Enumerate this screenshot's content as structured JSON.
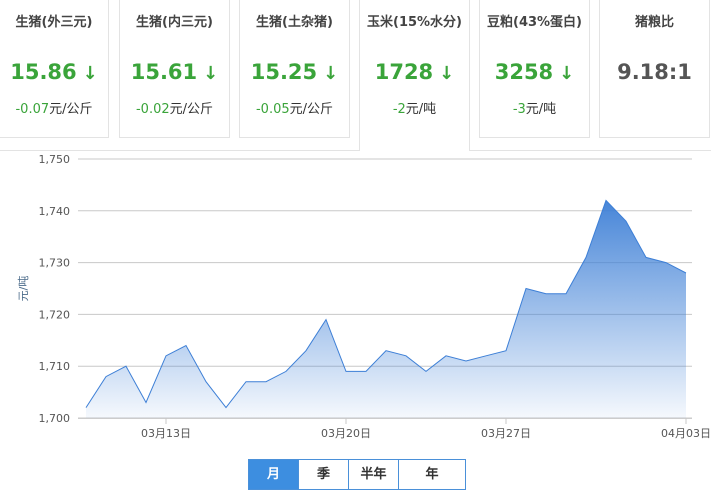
{
  "cards": [
    {
      "title": "生猪(外三元)",
      "value": "15.86",
      "arrow": "↓",
      "change": "-0.07",
      "unit": "元/公斤"
    },
    {
      "title": "生猪(内三元)",
      "value": "15.61",
      "arrow": "↓",
      "change": "-0.02",
      "unit": "元/公斤"
    },
    {
      "title": "生猪(土杂猪)",
      "value": "15.25",
      "arrow": "↓",
      "change": "-0.05",
      "unit": "元/公斤"
    },
    {
      "title": "玉米(15%水分)",
      "value": "1728",
      "arrow": "↓",
      "change": "-2",
      "unit": "元/吨"
    },
    {
      "title": "豆粕(43%蛋白)",
      "value": "3258",
      "arrow": "↓",
      "change": "-3",
      "unit": "元/吨"
    },
    {
      "title": "猪粮比",
      "value": "9.18:1"
    }
  ],
  "tabs": [
    "月",
    "季",
    "半年",
    "年"
  ],
  "colors": {
    "down": "#3aa43a",
    "line": "#3d7fd6",
    "active_tab": "#3d8ee0"
  },
  "chart_data": {
    "type": "area",
    "ylabel": "元/吨",
    "ylim": [
      1700,
      1750
    ],
    "yticks": [
      "1,700",
      "1,710",
      "1,720",
      "1,730",
      "1,740",
      "1,750"
    ],
    "xticks": [
      {
        "label": "03月13日",
        "index": 4
      },
      {
        "label": "03月20日",
        "index": 13
      },
      {
        "label": "03月27日",
        "index": 21
      },
      {
        "label": "04月03日",
        "index": 30
      }
    ],
    "series": [
      {
        "values": [
          1702,
          1708,
          1710,
          1703,
          1712,
          1714,
          1707,
          1702,
          1707,
          1707,
          1709,
          1713,
          1719,
          1709,
          1709,
          1713,
          1712,
          1709,
          1712,
          1711,
          1712,
          1713,
          1725,
          1724,
          1724,
          1731,
          1742,
          1738,
          1731,
          1730,
          1728
        ]
      }
    ],
    "grid": true
  }
}
